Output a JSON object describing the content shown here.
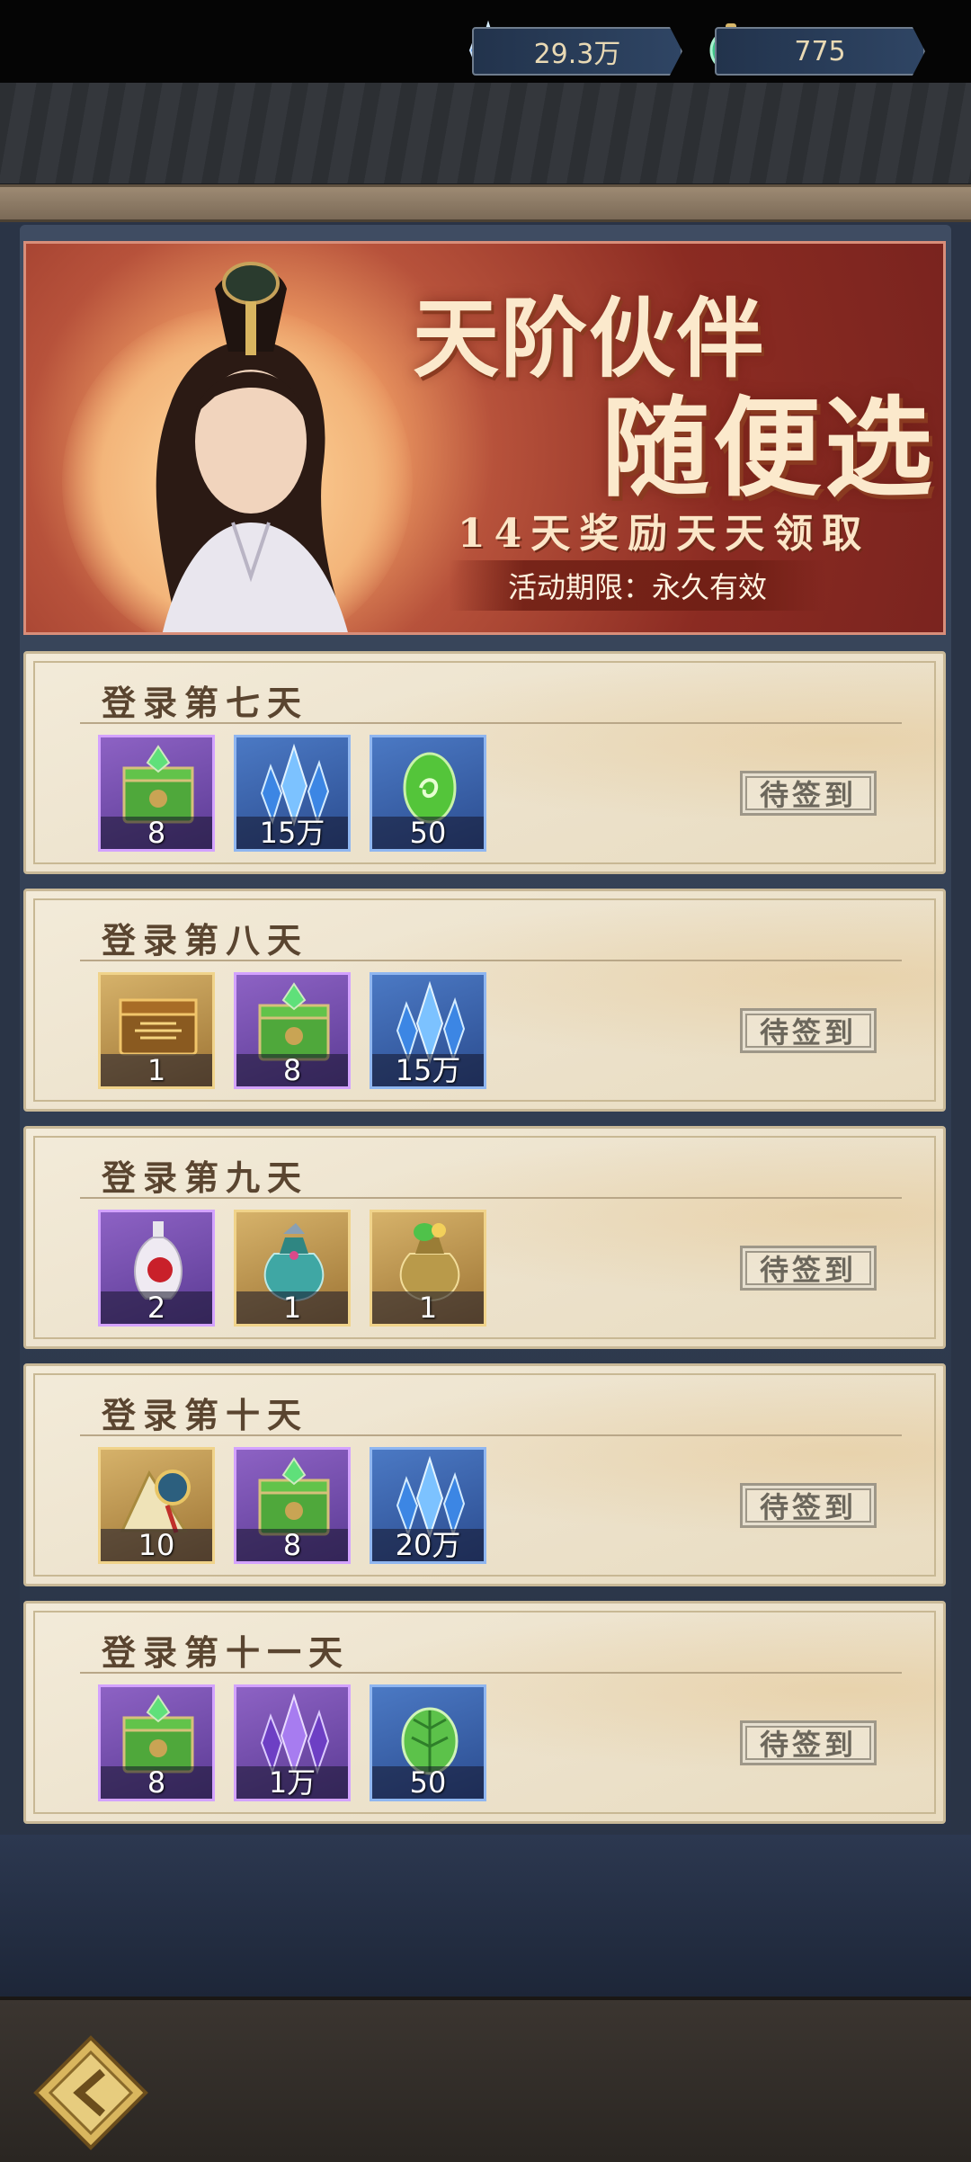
{
  "currencies": {
    "crystal": "29.3万",
    "jade": "775"
  },
  "banner": {
    "title_line1": "天阶伙伴",
    "title_line2": "随便选",
    "subtitle": "14天奖励天天领取",
    "period": "活动期限：永久有效"
  },
  "days": [
    {
      "title": "登录第七天",
      "button": "待签到",
      "items": [
        {
          "icon": "green-chest-icon",
          "qty": "8"
        },
        {
          "icon": "blue-crystal-icon",
          "qty": "15万"
        },
        {
          "icon": "jade-egg-icon",
          "qty": "50"
        }
      ]
    },
    {
      "title": "登录第八天",
      "button": "待签到",
      "items": [
        {
          "icon": "gold-chest-icon",
          "qty": "1"
        },
        {
          "icon": "green-chest-icon",
          "qty": "8"
        },
        {
          "icon": "blue-crystal-icon",
          "qty": "15万"
        }
      ]
    },
    {
      "title": "登录第九天",
      "button": "待签到",
      "items": [
        {
          "icon": "vase-icon",
          "qty": "2"
        },
        {
          "icon": "teal-bag-icon",
          "qty": "1"
        },
        {
          "icon": "gold-bag-icon",
          "qty": "1"
        }
      ]
    },
    {
      "title": "登录第十天",
      "button": "待签到",
      "items": [
        {
          "icon": "scroll-token-icon",
          "qty": "10"
        },
        {
          "icon": "green-chest-icon",
          "qty": "8"
        },
        {
          "icon": "blue-crystal-icon",
          "qty": "20万"
        }
      ]
    },
    {
      "title": "登录第十一天",
      "button": "待签到",
      "items": [
        {
          "icon": "green-chest-icon",
          "qty": "8"
        },
        {
          "icon": "purple-crystal-icon",
          "qty": "1万"
        },
        {
          "icon": "green-leaf-icon",
          "qty": "50"
        }
      ]
    }
  ]
}
